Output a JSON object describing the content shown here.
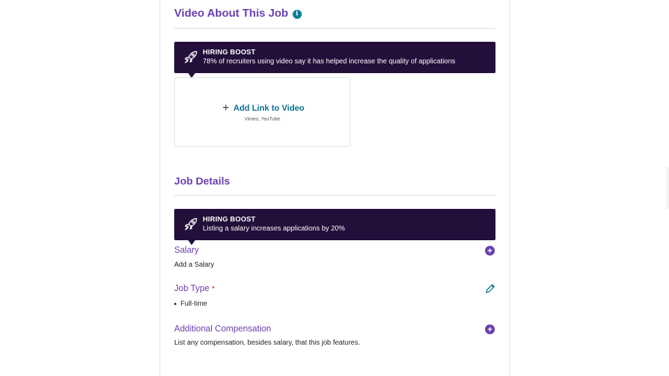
{
  "video_section": {
    "title": "Video About This Job",
    "info_icon": "i",
    "boost": {
      "title": "HIRING BOOST",
      "text": "78% of recruiters using video say it has helped increase the quality of applications"
    },
    "add_link_label": "Add Link to Video",
    "add_link_icon": "+",
    "providers": "Vimeo, YouTube"
  },
  "job_details": {
    "title": "Job Details",
    "boost": {
      "title": "HIRING BOOST",
      "text": "Listing a salary increases applications by 20%"
    },
    "salary": {
      "label": "Salary",
      "value": "Add a Salary"
    },
    "job_type": {
      "label": "Job Type",
      "required_mark": "*",
      "values": [
        "Full-time"
      ]
    },
    "additional_compensation": {
      "label": "Additional Compensation",
      "value": "List any compensation, besides salary, that this job features."
    },
    "add_icon": "+"
  },
  "colors": {
    "accent": "#6a3fb0",
    "boost_bg": "#230f3a",
    "link": "#0a6f8f",
    "info": "#0a7f97",
    "required": "#d0262c"
  }
}
